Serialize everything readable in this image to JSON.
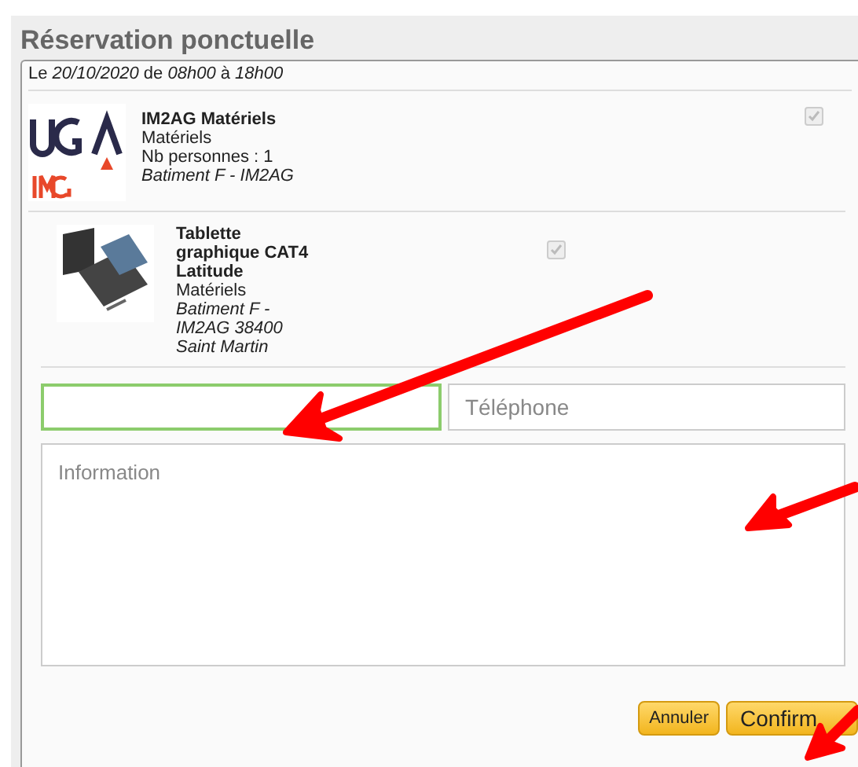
{
  "dialog": {
    "title": "Réservation ponctuelle"
  },
  "date_line": "Le *20/10/2020* de *08h00* à *18h00*",
  "items": [
    {
      "kind": "logo",
      "name": "IM2AG Matériels",
      "lines": [
        {
          "text": "Matériels",
          "italic": false
        },
        {
          "text": "Nb personnes : 1",
          "italic": false
        },
        {
          "text": "Batiment F - IM2AG",
          "italic": true
        }
      ],
      "checked": true,
      "disabled": true
    },
    {
      "kind": "photo",
      "name": "Tablette graphique CAT4 Latitude",
      "lines": [
        {
          "text": "Matériels",
          "italic": false
        },
        {
          "text": "Batiment F - IM2AG 38400 Saint Martin",
          "italic": true
        }
      ],
      "checked": true,
      "disabled": true
    }
  ],
  "fields": [
    {
      "focused": true
    },
    {
      "placeholder": "Téléphone",
      "focused": false
    }
  ],
  "information": {
    "placeholder": "Information"
  },
  "buttons": [
    "Annuler",
    "Confirm"
  ]
}
